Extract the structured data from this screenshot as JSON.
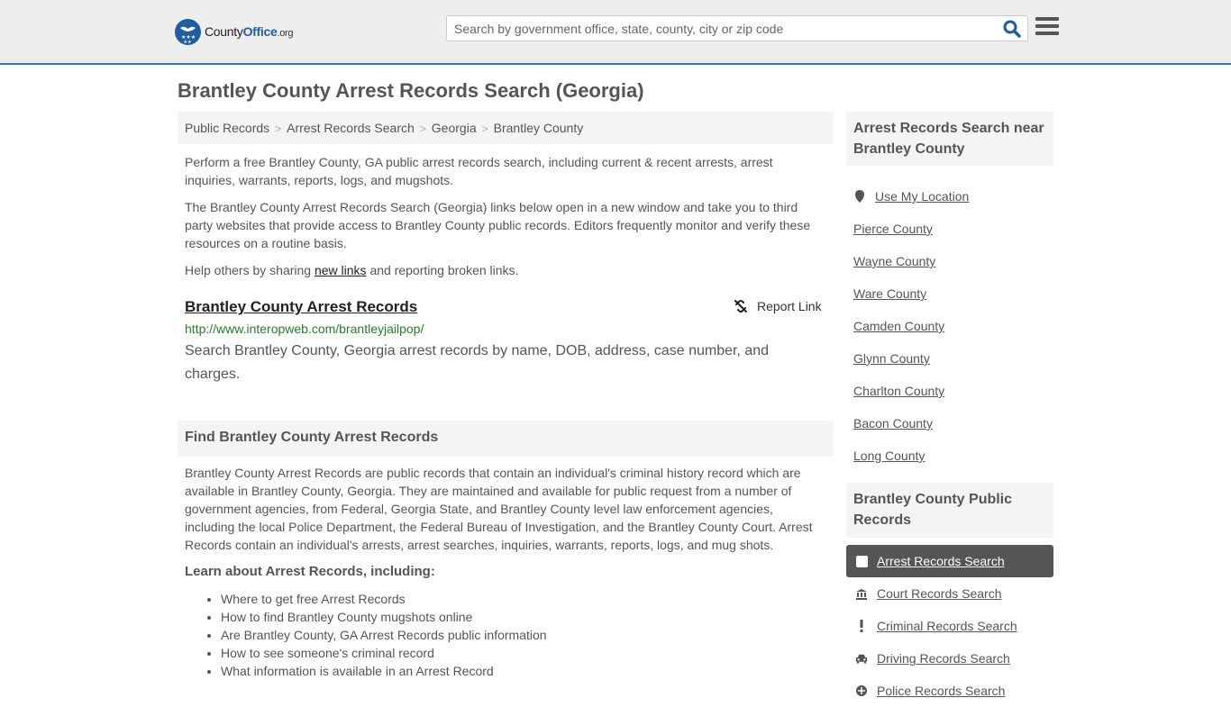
{
  "header": {
    "logo": {
      "brand_plain": "County",
      "brand_bold": "Office",
      "brand_tld": ".org"
    },
    "search": {
      "placeholder": "Search by government office, state, county, city or zip code",
      "value": ""
    },
    "brand_color": "#1f5da0",
    "accent_line_color": "#2f78b4"
  },
  "page": {
    "title": "Brantley County Arrest Records Search (Georgia)"
  },
  "breadcrumb": [
    {
      "label": "Public Records"
    },
    {
      "label": "Arrest Records Search"
    },
    {
      "label": "Georgia"
    },
    {
      "label": "Brantley County"
    }
  ],
  "intro": {
    "p1": "Perform a free Brantley County, GA public arrest records search, including current & recent arrests, arrest inquiries, warrants, reports, logs, and mugshots.",
    "p2": "The Brantley County Arrest Records Search (Georgia) links below open in a new window and take you to third party websites that provide access to Brantley County public records. Editors frequently monitor and verify these resources on a routine basis.",
    "p3_before": "Help others by sharing ",
    "p3_link": "new links",
    "p3_after": " and reporting broken links."
  },
  "result": {
    "title": "Brantley County Arrest Records",
    "url": "http://www.interopweb.com/brantleyjailpop/",
    "description": "Search Brantley County, Georgia arrest records by name, DOB, address, case number, and charges.",
    "report_label": "Report Link"
  },
  "find_section": {
    "heading": "Find Brantley County Arrest Records",
    "body": "Brantley County Arrest Records are public records that contain an individual's criminal history record which are available in Brantley County, Georgia. They are maintained and available for public request from a number of government agencies, from Federal, Georgia State, and Brantley County level law enforcement agencies, including the local Police Department, the Federal Bureau of Investigation, and the Brantley County Court. Arrest Records contain an individual's arrests, arrest searches, inquiries, warrants, reports, logs, and mug shots.",
    "learn_heading": "Learn about Arrest Records, including:",
    "learn_items": [
      "Where to get free Arrest Records",
      "How to find Brantley County mugshots online",
      "Are Brantley County, GA Arrest Records public information",
      "How to see someone's criminal record",
      "What information is available in an Arrest Record"
    ]
  },
  "sidebar": {
    "near_heading": "Arrest Records Search near Brantley County",
    "use_location": "Use My Location",
    "near_items": [
      "Pierce County",
      "Wayne County",
      "Ware County",
      "Camden County",
      "Glynn County",
      "Charlton County",
      "Bacon County",
      "Long County"
    ],
    "public_heading": "Brantley County Public Records",
    "records": [
      {
        "label": "Arrest Records Search",
        "icon": "square-icon",
        "active": true
      },
      {
        "label": "Court Records Search",
        "icon": "courthouse-icon",
        "active": false
      },
      {
        "label": "Criminal Records Search",
        "icon": "exclamation-icon",
        "active": false
      },
      {
        "label": "Driving Records Search",
        "icon": "car-icon",
        "active": false
      },
      {
        "label": "Police Records Search",
        "icon": "police-icon",
        "active": false
      }
    ]
  }
}
